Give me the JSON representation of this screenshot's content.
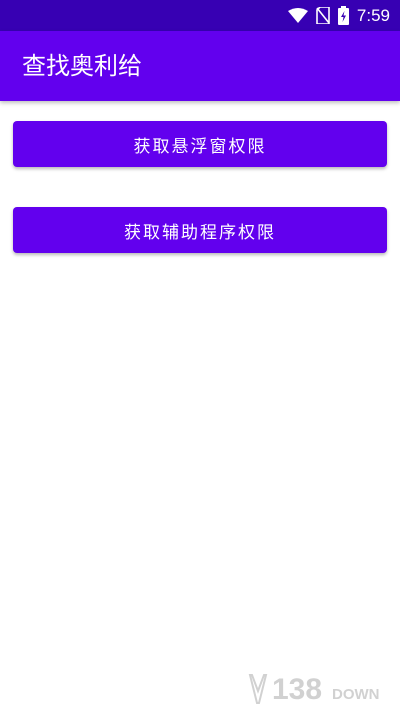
{
  "status_bar": {
    "time": "7:59",
    "icons": [
      "wifi-icon",
      "no-sim-icon",
      "battery-charging-icon"
    ],
    "background": "#3700b3"
  },
  "app_bar": {
    "title": "查找奥利给",
    "background": "#6200ee"
  },
  "buttons": [
    {
      "label": "获取悬浮窗权限"
    },
    {
      "label": "获取辅助程序权限"
    }
  ],
  "watermark": {
    "text": "138DOWN"
  },
  "colors": {
    "accent": "#6200ee",
    "text_on_accent": "#ffffff"
  }
}
